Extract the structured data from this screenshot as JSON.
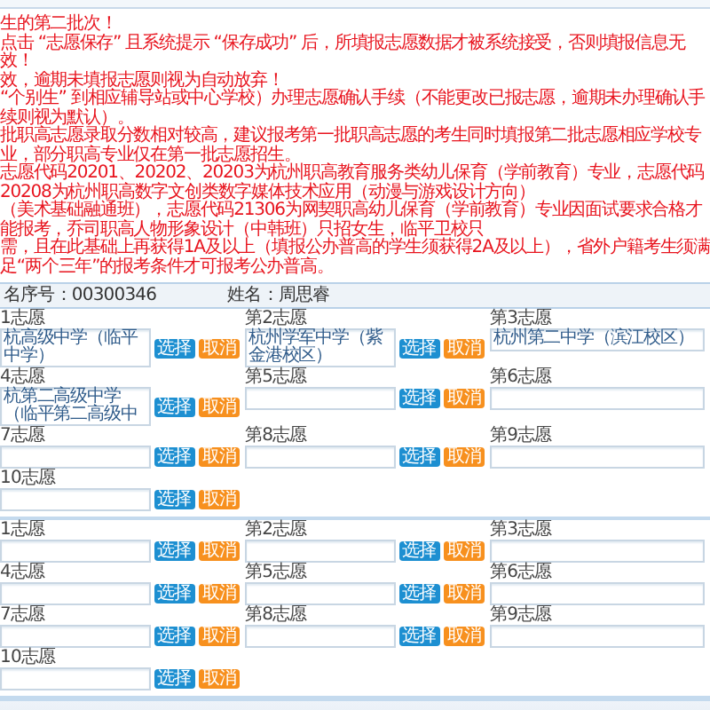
{
  "notice": [
    "生的第二批次！",
    "点击 “志愿保存” 且系统提示 “保存成功” 后，所填报志愿数据才被系统接受，否则填报信息无效！",
    "效，逾期未填报志愿则视为自动放弃！",
    "“个别生” 到相应辅导站或中心学校）办理志愿确认手续（不能更改已报志愿，逾期未办理确认手续则视为默认）。",
    "批职高志愿录取分数相对较高，建议报考第一批职高志愿的考生同时填报第二批志愿相应学校专业，部分职高专业仅在第一批志愿招生。",
    "志愿代码20201、20202、20203为杭州职高教育服务类幼儿保育（学前教育）专业，志愿代码20208为杭州职高数字文创类数字媒体技术应用（动漫与游戏设计方向）",
    "（美术基础融通班），志愿代码21306为网契职高幼儿保育（学前教育）专业因面试要求合格才能报考，乔司职高人物形象设计（中韩班）只招女生，临平卫校只",
    "需，且在此基础上再获得1A及以上（填报公办普高的学生须获得2A及以上），省外户籍考生须满足“两个三年”的报考条件才可报考公办普高。"
  ],
  "info": {
    "reg_no": "名序号：00300346",
    "name": "姓名：周思睿"
  },
  "sections": [
    {
      "choices": [
        {
          "label": "1志愿",
          "value": "杭高级中学（临平中学）",
          "select": "选择",
          "cancel": "取消"
        },
        {
          "label": "第2志愿",
          "value": "杭州学军中学（紫金港校区）",
          "select": "选择",
          "cancel": "取消"
        },
        {
          "label": "第3志愿",
          "value": "杭州第二中学（滨江校区）"
        },
        {
          "label": "4志愿",
          "value": "杭第二高级中学（临平第二高级中",
          "select": "选择",
          "cancel": "取消"
        },
        {
          "label": "第5志愿",
          "select": "选择",
          "cancel": "取消"
        },
        {
          "label": "第6志愿"
        },
        {
          "label": "7志愿",
          "select": "选择",
          "cancel": "取消"
        },
        {
          "label": "第8志愿",
          "select": "选择",
          "cancel": "取消"
        },
        {
          "label": "第9志愿"
        },
        {
          "label": "10志愿",
          "select": "选择",
          "cancel": "取消"
        }
      ]
    },
    {
      "choices": [
        {
          "label": "1志愿",
          "select": "选择",
          "cancel": "取消"
        },
        {
          "label": "第2志愿",
          "select": "选择",
          "cancel": "取消"
        },
        {
          "label": "第3志愿"
        },
        {
          "label": "4志愿",
          "select": "选择",
          "cancel": "取消"
        },
        {
          "label": "第5志愿",
          "select": "选择",
          "cancel": "取消"
        },
        {
          "label": "第6志愿"
        },
        {
          "label": "7志愿",
          "select": "选择",
          "cancel": "取消"
        },
        {
          "label": "第8志愿",
          "select": "选择",
          "cancel": "取消"
        },
        {
          "label": "第9志愿"
        },
        {
          "label": "10志愿",
          "select": "选择",
          "cancel": "取消"
        }
      ]
    }
  ]
}
